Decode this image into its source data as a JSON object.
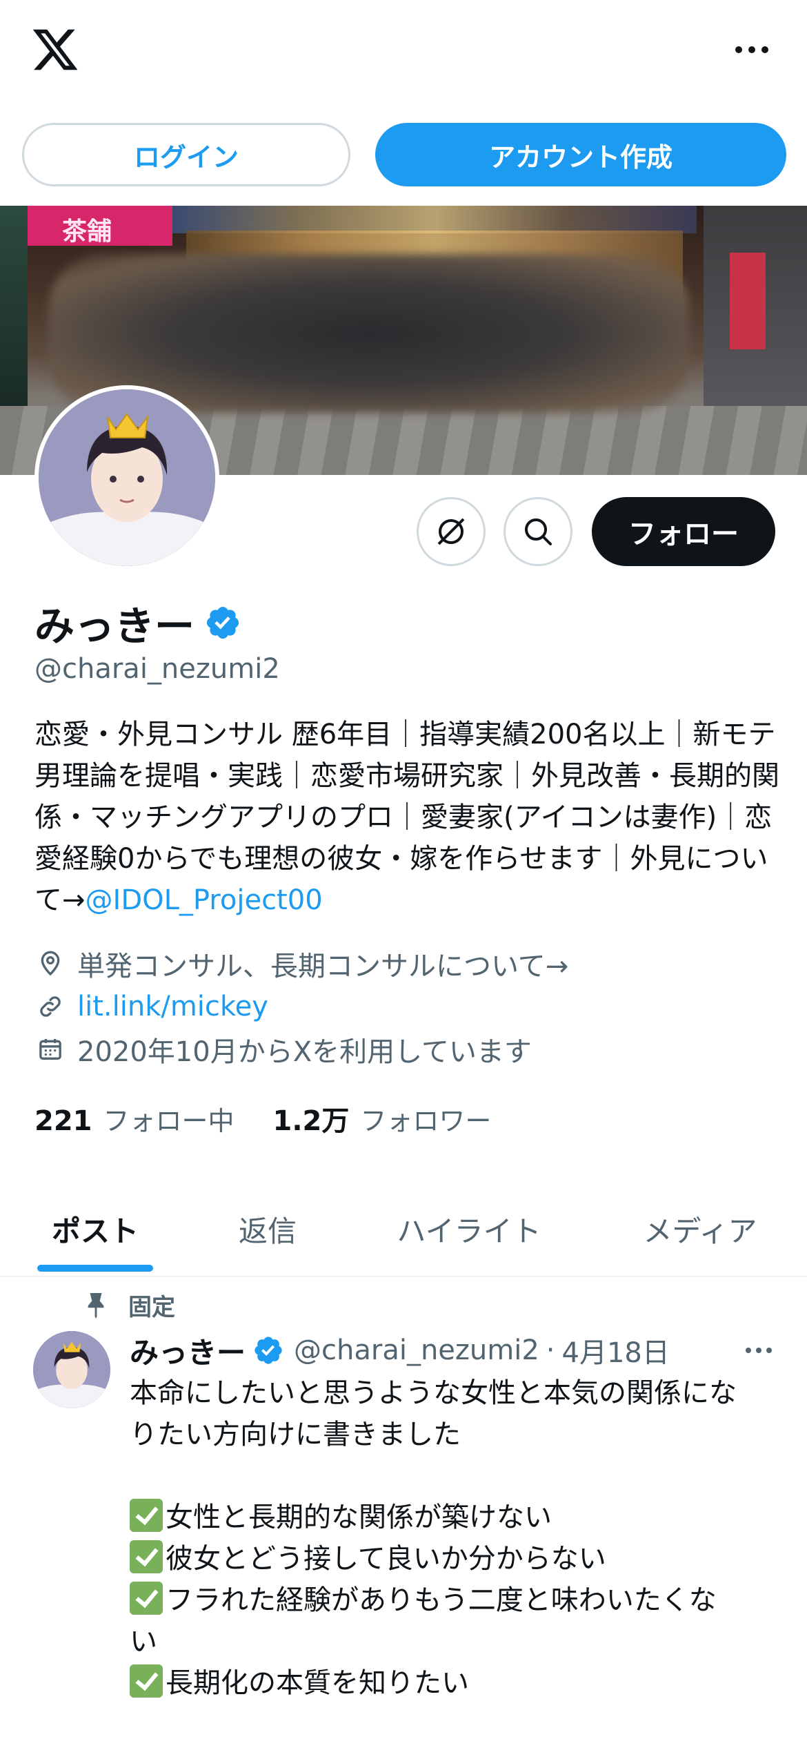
{
  "header": {
    "logo": "x-logo",
    "more_icon": "more-horizontal-icon"
  },
  "auth": {
    "login_label": "ログイン",
    "signup_label": "アカウント作成"
  },
  "banner": {
    "sign_text": "茶舗"
  },
  "profile": {
    "name": "みっきー",
    "handle": "@charai_nezumi2",
    "follow_label": "フォロー",
    "bio_text": "恋愛・外見コンサル 歴6年目｜指導実績200名以上｜新モテ男理論を提唱・実践｜恋愛市場研究家｜外見改善・長期的関係・マッチングアプリのプロ｜愛妻家(アイコンは妻作)｜恋愛経験0からでも理想の彼女・嫁を作らせます｜外見について→",
    "bio_mention": "@IDOL_Project00",
    "location": "単発コンサル、長期コンサルについて→",
    "link": "lit.link/mickey",
    "joined": "2020年10月からXを利用しています",
    "following_count": "221",
    "following_label": "フォロー中",
    "followers_count": "1.2万",
    "followers_label": "フォロワー"
  },
  "tabs": [
    {
      "label": "ポスト",
      "active": true
    },
    {
      "label": "返信",
      "active": false
    },
    {
      "label": "ハイライト",
      "active": false
    },
    {
      "label": "メディア",
      "active": false
    }
  ],
  "post": {
    "pinned_label": "固定",
    "author_name": "みっきー",
    "author_handle": "@charai_nezumi2",
    "separator": "·",
    "date": "4月18日",
    "lines": [
      "本命にしたいと思うような女性と本気の関係にな",
      "りたい方向けに書きました",
      ""
    ],
    "checklist": [
      "女性と長期的な関係が築けない",
      "彼女とどう接して良いか分からない",
      "フラれた経験がありもう二度と味わいたくな",
      "長期化の本質を知りたい"
    ],
    "checklist_continuation": "い"
  },
  "colors": {
    "accent": "#1d9bf0",
    "text": "#0f1419",
    "secondary": "#536471",
    "border": "#cfd9de",
    "check_green": "#78b159"
  }
}
